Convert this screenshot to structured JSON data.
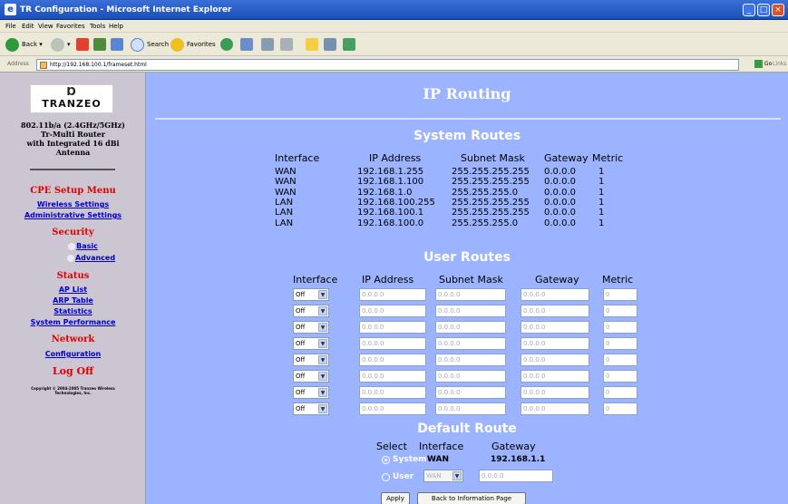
{
  "window": {
    "title": "TR Configuration - Microsoft Internet Explorer"
  },
  "menu": [
    "File",
    "Edit",
    "View",
    "Favorites",
    "Tools",
    "Help"
  ],
  "toolbar": {
    "back": "Back",
    "search": "Search",
    "favorites": "Favorites"
  },
  "address": {
    "label": "Address",
    "url": "http://192.168.100.1/frameset.html",
    "go": "Go",
    "links": "Links"
  },
  "sidebar": {
    "logo_mark": "Ɒ",
    "logo_text": "TRANZEO",
    "product": [
      "802.11b/a (2.4GHz/5GHz)",
      "Tr-Multi Router",
      "with Integrated 16 dBi",
      "Antenna"
    ],
    "cpe_menu": "CPE Setup Menu",
    "wireless": "Wireless Settings",
    "administrative": "Administrative Settings",
    "security": "Security",
    "basic": "Basic",
    "advanced": "Advanced",
    "status": "Status",
    "ap_list": "AP List",
    "arp_table": "ARP Table",
    "statistics": "Statistics",
    "system_performance": "System Performance",
    "network": "Network",
    "configuration": "Configuration",
    "logoff": "Log Off",
    "copyright": [
      "Copyright © 2004-2005 Tranzeo Wireless",
      "Technologies, Inc."
    ]
  },
  "page": {
    "title": "IP Routing",
    "system_routes": {
      "title": "System Routes",
      "headers": [
        "Interface",
        "IP Address",
        "Subnet Mask",
        "Gateway",
        "Metric"
      ],
      "rows": [
        [
          "WAN",
          "192.168.1.255",
          "255.255.255.255",
          "0.0.0.0",
          "1"
        ],
        [
          "WAN",
          "192.168.1.100",
          "255.255.255.255",
          "0.0.0.0",
          "1"
        ],
        [
          "WAN",
          "192.168.1.0",
          "255.255.255.0",
          "0.0.0.0",
          "1"
        ],
        [
          "LAN",
          "192.168.100.255",
          "255.255.255.255",
          "0.0.0.0",
          "1"
        ],
        [
          "LAN",
          "192.168.100.1",
          "255.255.255.255",
          "0.0.0.0",
          "1"
        ],
        [
          "LAN",
          "192.168.100.0",
          "255.255.255.0",
          "0.0.0.0",
          "1"
        ]
      ]
    },
    "user_routes": {
      "title": "User Routes",
      "headers": [
        "Interface",
        "IP Address",
        "Subnet Mask",
        "Gateway",
        "Metric"
      ],
      "rows": [
        {
          "iface": "Off",
          "ip": "0.0.0.0",
          "mask": "0.0.0.0",
          "gw": "0.0.0.0",
          "metric": "0"
        },
        {
          "iface": "Off",
          "ip": "0.0.0.0",
          "mask": "0.0.0.0",
          "gw": "0.0.0.0",
          "metric": "0"
        },
        {
          "iface": "Off",
          "ip": "0.0.0.0",
          "mask": "0.0.0.0",
          "gw": "0.0.0.0",
          "metric": "0"
        },
        {
          "iface": "Off",
          "ip": "0.0.0.0",
          "mask": "0.0.0.0",
          "gw": "0.0.0.0",
          "metric": "0"
        },
        {
          "iface": "Off",
          "ip": "0.0.0.0",
          "mask": "0.0.0.0",
          "gw": "0.0.0.0",
          "metric": "0"
        },
        {
          "iface": "Off",
          "ip": "0.0.0.0",
          "mask": "0.0.0.0",
          "gw": "0.0.0.0",
          "metric": "0"
        },
        {
          "iface": "Off",
          "ip": "0.0.0.0",
          "mask": "0.0.0.0",
          "gw": "0.0.0.0",
          "metric": "0"
        },
        {
          "iface": "Off",
          "ip": "0.0.0.0",
          "mask": "0.0.0.0",
          "gw": "0.0.0.0",
          "metric": "0"
        }
      ]
    },
    "default_route": {
      "title": "Default Route",
      "headers": [
        "Select",
        "Interface",
        "Gateway"
      ],
      "system_label": "System",
      "system_iface": "WAN",
      "system_gw": "192.168.1.1",
      "user_label": "User",
      "user_iface": "WAN",
      "user_gw": "0.0.0.0",
      "selected": "system"
    },
    "apply": "Apply",
    "back": "Back to Information Page"
  },
  "colors": {
    "sidebar": "#ccc6d2",
    "content": "#9cb4ff",
    "menu_red": "#e00000",
    "link_blue": "#0000c8"
  }
}
